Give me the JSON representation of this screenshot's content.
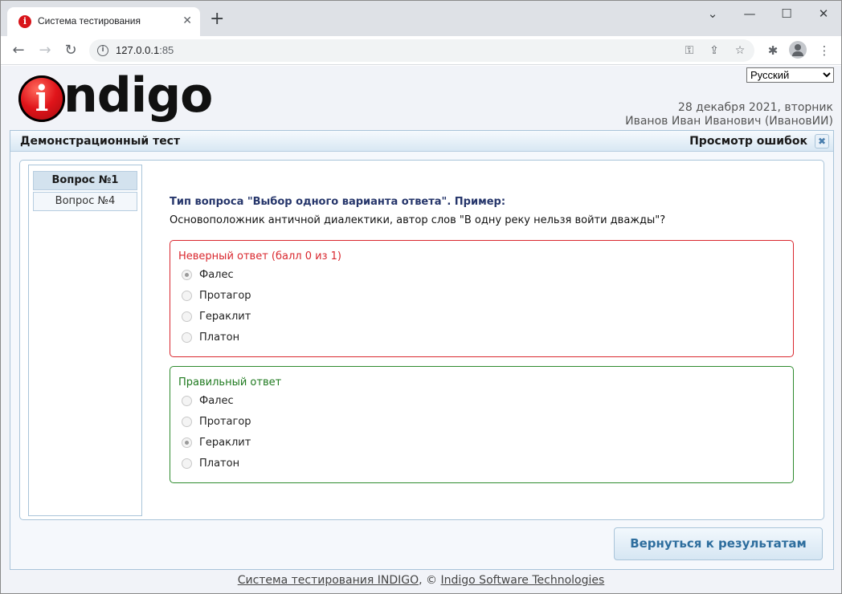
{
  "browser": {
    "tab_title": "Система тестирования",
    "tab_close": "✕",
    "new_tab": "+",
    "url_host": "127.0.0.1",
    "url_port": ":85",
    "window_controls": {
      "collapse": "⌄",
      "minimize": "—",
      "maximize": "☐",
      "close": "✕"
    }
  },
  "header": {
    "language": "Русский",
    "language_options": [
      "Русский"
    ],
    "logo_letter": "i",
    "logo_text": "ndigo",
    "date": "28 декабря 2021, вторник",
    "user": "Иванов Иван Иванович (ИвановИИ)"
  },
  "panel": {
    "title": "Демонстрационный тест",
    "mode": "Просмотр ошибок",
    "close_glyph": "✖"
  },
  "question_nav": [
    {
      "label": "Вопрос №1",
      "active": true
    },
    {
      "label": "Вопрос №4",
      "active": false
    }
  ],
  "question": {
    "type": "Тип вопроса \"Выбор одного варианта ответа\". Пример:",
    "text": "Основоположник античной диалектики, автор слов \"В одну реку нельзя войти дважды\"?"
  },
  "wrong_answer": {
    "label": "Неверный ответ (балл 0 из 1)",
    "options": [
      {
        "label": "Фалес",
        "checked": true
      },
      {
        "label": "Протагор",
        "checked": false
      },
      {
        "label": "Гераклит",
        "checked": false
      },
      {
        "label": "Платон",
        "checked": false
      }
    ]
  },
  "correct_answer": {
    "label": "Правильный ответ",
    "options": [
      {
        "label": "Фалес",
        "checked": false
      },
      {
        "label": "Протагор",
        "checked": false
      },
      {
        "label": "Гераклит",
        "checked": true
      },
      {
        "label": "Платон",
        "checked": false
      }
    ]
  },
  "return_button": "Вернуться к результатам",
  "footer": {
    "link1": "Система тестирования INDIGO",
    "separator": ", © ",
    "link2": "Indigo Software Technologies"
  },
  "colors": {
    "wrong": "#d9272e",
    "correct": "#2e8b2e",
    "accent": "#2e6e9e"
  }
}
